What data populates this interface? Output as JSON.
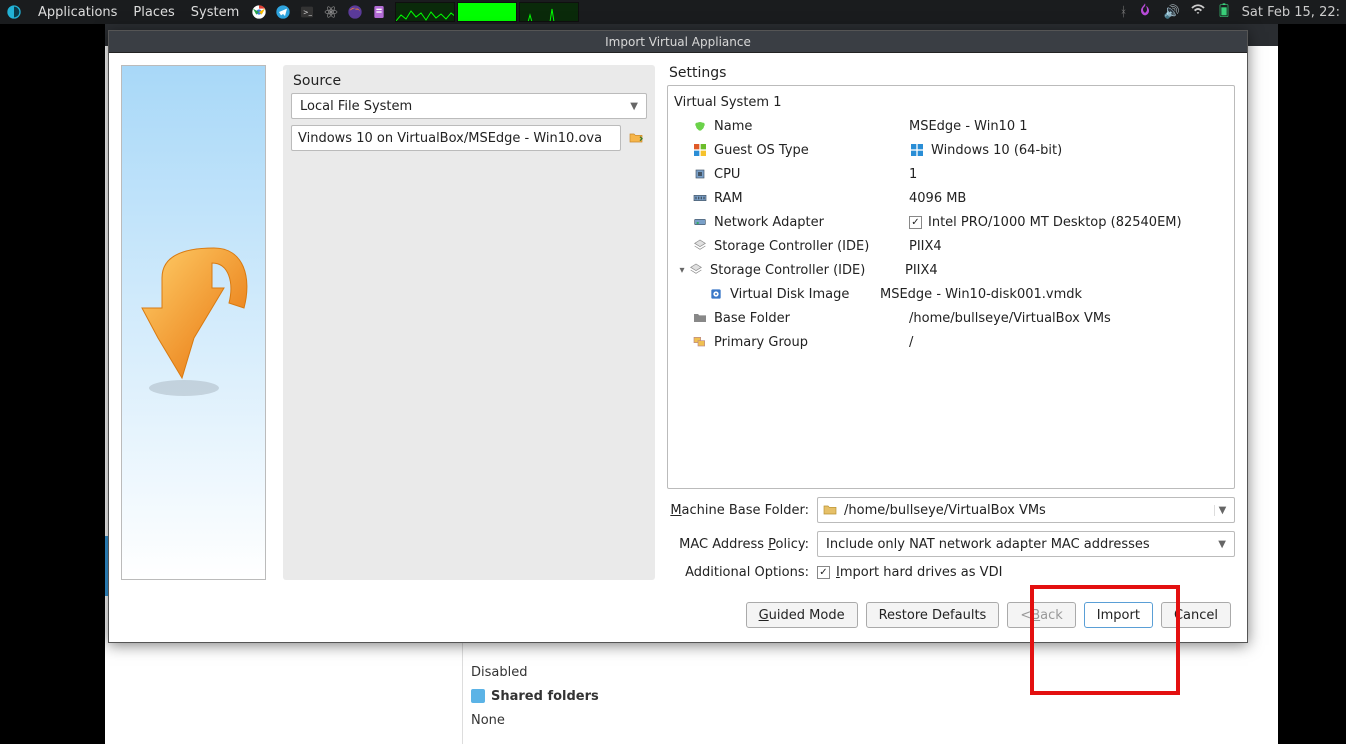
{
  "panel": {
    "applications": "Applications",
    "places": "Places",
    "system": "System",
    "datetime": "Sat Feb 15, 22:"
  },
  "bg": {
    "disabled": "Disabled",
    "shared_folders": "Shared folders",
    "none": "None"
  },
  "dialog": {
    "title": "Import Virtual Appliance",
    "source": {
      "header": "Source",
      "dropdown": "Local File System",
      "file_path": "Vindows 10 on VirtualBox/MSEdge - Win10.ova"
    },
    "settings": {
      "header": "Settings",
      "root": "Virtual System 1",
      "rows": [
        {
          "label": "Name",
          "value": "MSEdge - Win10 1",
          "icon": "name"
        },
        {
          "label": "Guest OS Type",
          "value": "Windows 10 (64-bit)",
          "icon": "os",
          "valicon": "win"
        },
        {
          "label": "CPU",
          "value": "1",
          "icon": "cpu"
        },
        {
          "label": "RAM",
          "value": "4096 MB",
          "icon": "ram"
        },
        {
          "label": "Network Adapter",
          "value": "Intel PRO/1000 MT Desktop (82540EM)",
          "icon": "net",
          "check": true
        },
        {
          "label": "Storage Controller (IDE)",
          "value": "PIIX4",
          "icon": "stor"
        },
        {
          "label": "Storage Controller (IDE)",
          "value": "PIIX4",
          "icon": "stor",
          "expand": true
        },
        {
          "label": "Virtual Disk Image",
          "value": "MSEdge - Win10-disk001.vmdk",
          "icon": "disk",
          "indent": 2
        },
        {
          "label": "Base Folder",
          "value": "/home/bullseye/VirtualBox VMs",
          "icon": "folder"
        },
        {
          "label": "Primary Group",
          "value": "/",
          "icon": "group"
        }
      ]
    },
    "options": {
      "machine_base_folder_label": "Machine Base Folder:",
      "machine_base_folder_value": "/home/bullseye/VirtualBox VMs",
      "mac_label": "MAC Address Policy:",
      "mac_value": "Include only NAT network adapter MAC addresses",
      "additional_label": "Additional Options:",
      "vdi_checkbox": "Import hard drives as VDI"
    },
    "buttons": {
      "guided": "Guided Mode",
      "restore": "Restore Defaults",
      "back": "< Back",
      "import": "Import",
      "cancel": "Cancel"
    }
  }
}
